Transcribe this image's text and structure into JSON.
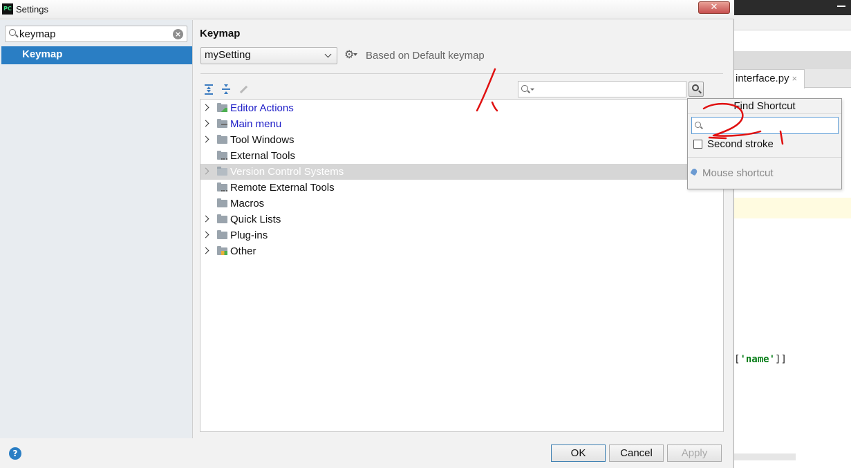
{
  "window": {
    "title": "Settings",
    "app_icon": "PC",
    "close_label": "✕"
  },
  "background_ide": {
    "tab_label": "interface.py",
    "tab_close": "×",
    "code_prefix": "[",
    "code_string": "'name'",
    "code_suffix": "]]"
  },
  "sidebar": {
    "search_value": "keymap",
    "clear_glyph": "×",
    "items": [
      {
        "label": "Keymap",
        "selected": true
      }
    ]
  },
  "main": {
    "title": "Keymap",
    "keymap_select_value": "mySetting",
    "based_on": "Based on Default keymap",
    "tree": [
      {
        "label": "Editor Actions",
        "expandable": true,
        "color": "#2020c8"
      },
      {
        "label": "Main menu",
        "expandable": true,
        "color": "#2020c8"
      },
      {
        "label": "Tool Windows",
        "expandable": true
      },
      {
        "label": "External Tools",
        "expandable": false
      },
      {
        "label": "Version Control Systems",
        "expandable": true,
        "highlighted": true
      },
      {
        "label": "Remote External Tools",
        "expandable": false
      },
      {
        "label": "Macros",
        "expandable": false
      },
      {
        "label": "Quick Lists",
        "expandable": true
      },
      {
        "label": "Plug-ins",
        "expandable": true
      },
      {
        "label": "Other",
        "expandable": true
      }
    ]
  },
  "find_shortcut_popup": {
    "title": "Find Shortcut",
    "input_value": "",
    "second_stroke_label": "Second stroke",
    "second_stroke_checked": false,
    "mouse_shortcut_label": "Mouse shortcut"
  },
  "footer": {
    "help_glyph": "?",
    "ok_label": "OK",
    "cancel_label": "Cancel",
    "apply_label": "Apply"
  },
  "colors": {
    "accent": "#2a7ec4",
    "annotation": "#e01010",
    "tree_link": "#2020c8"
  }
}
